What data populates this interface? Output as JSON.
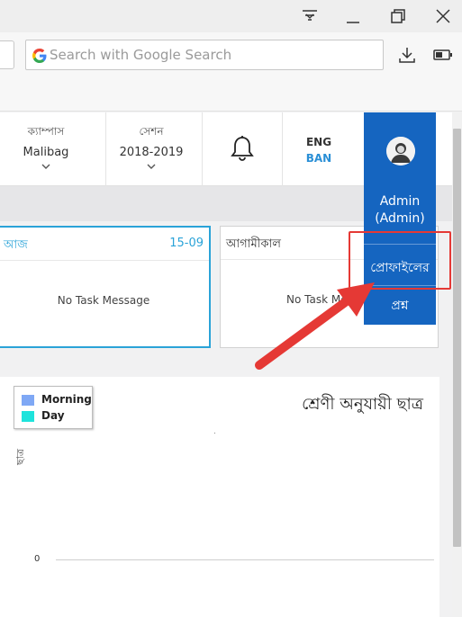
{
  "browser": {
    "search_placeholder": "Search with Google Search"
  },
  "header": {
    "campus_label": "ক্যাম্পাস",
    "campus_value": "Malibag",
    "session_label": "সেশন",
    "session_value": "2018-2019",
    "lang_eng": "ENG",
    "lang_ban": "BAN"
  },
  "tasks": {
    "today_title": "আজ",
    "today_date": "15-09",
    "today_message": "No Task Message",
    "tomorrow_title": "আগামীকাল",
    "tomorrow_message": "No Task Me"
  },
  "admin_menu": {
    "name": "Admin",
    "role": "(Admin)",
    "profile": "প্রোফাইলের",
    "question": "প্রশ্ন"
  },
  "colors": {
    "admin_bg": "#1565c0",
    "today_accent": "#2aa3d8",
    "highlight": "#e53935",
    "morning": "#7fa8f5",
    "day": "#1ee3dc"
  },
  "chart_data": {
    "type": "bar",
    "title": "শ্রেণী অনুযায়ী ছাত্র",
    "ylabel": "ছাত্র",
    "yticks": [
      "0"
    ],
    "series": [
      {
        "name": "Morning",
        "values": []
      },
      {
        "name": "Day",
        "values": []
      }
    ],
    "legend": "top-left"
  }
}
